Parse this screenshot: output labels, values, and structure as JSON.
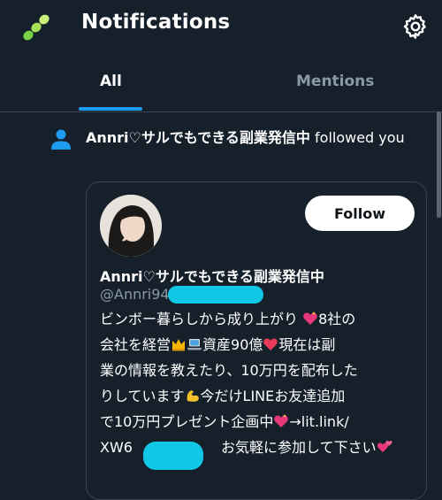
{
  "header": {
    "title": "Notifications"
  },
  "tabs": [
    {
      "label": "All",
      "active": true
    },
    {
      "label": "Mentions",
      "active": false
    }
  ],
  "notification": {
    "user": "Annri♡サルでもできる副業発信中",
    "action": " followed you"
  },
  "card": {
    "display_name": "Annri♡サルでもできる副業発信中",
    "handle": "@Annri94",
    "follow_label": "Follow",
    "bio": {
      "l1a": "ビンボー暮らしから成り上がり",
      "l1b": "8社の",
      "l2a": "会社を経営",
      "l2b": "資産90億",
      "l2c": "現在は副",
      "l3": "業の情報を教えたり、10万円を配布した",
      "l4a": "りしています",
      "l4b": "今だけLINEお友達追加",
      "l5a": "で10万円プレゼント企画中",
      "l5b": "→lit.link/",
      "l6a": "XW6",
      "l6b": " お気軽に参加して下さい"
    }
  },
  "colors": {
    "background": "#15202b",
    "accent": "#1d9bf0",
    "muted_text": "#8b98a5",
    "border": "#38444d",
    "redaction": "#10c8e6"
  }
}
